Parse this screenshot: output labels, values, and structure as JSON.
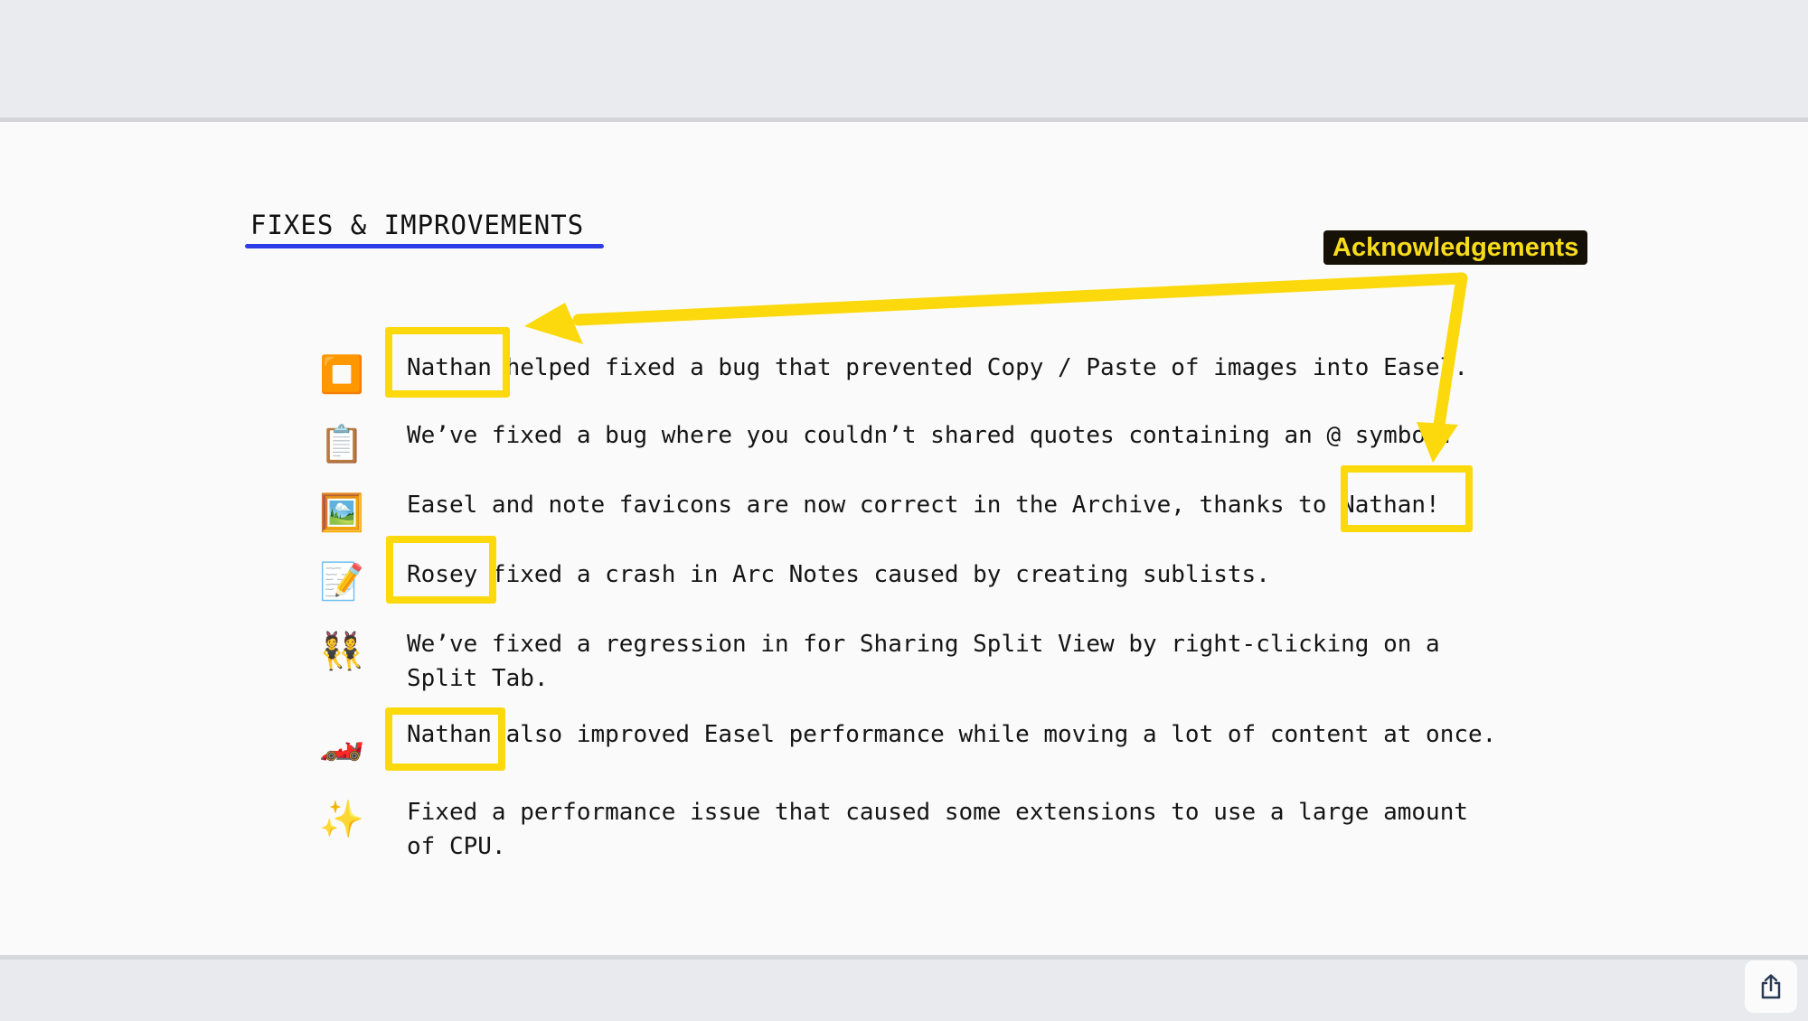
{
  "section": {
    "title": "FIXES & IMPROVEMENTS",
    "accent_color": "#2e3ee6"
  },
  "annotation": {
    "label": "Acknowledgements",
    "label_bg": "#151106",
    "label_color": "#f7dc1c",
    "highlight_color": "#fbd90c",
    "highlighted_names": [
      "Nathan",
      "Nathan!",
      "Rosey",
      "Nathan"
    ]
  },
  "items": [
    {
      "icon": "stop-button-icon",
      "glyph": "⏹️",
      "text": "Nathan helped fixed a bug that prevented Copy / Paste of images into Easel."
    },
    {
      "icon": "clipboard-icon",
      "glyph": "📋",
      "text": "We’ve fixed a bug where you couldn’t shared quotes containing an @ symbol."
    },
    {
      "icon": "framed-picture-icon",
      "glyph": "🖼️",
      "text": "Easel and note favicons are now correct in the Archive, thanks to Nathan!"
    },
    {
      "icon": "memo-pencil-icon",
      "glyph": "📝",
      "text": "Rosey fixed a crash in Arc Notes caused by creating sublists."
    },
    {
      "icon": "dancers-icon",
      "glyph": "👯",
      "text": "We’ve fixed a regression in for Sharing Split View by right-clicking on a\nSplit Tab."
    },
    {
      "icon": "race-car-icon",
      "glyph": "🏎️",
      "text": "Nathan also improved Easel performance while moving a lot of content at once."
    },
    {
      "icon": "sparkles-icon",
      "glyph": "✨",
      "text": "Fixed a performance issue that caused some extensions to use a large amount\nof CPU."
    }
  ],
  "share_button": {
    "icon": "share-icon"
  }
}
